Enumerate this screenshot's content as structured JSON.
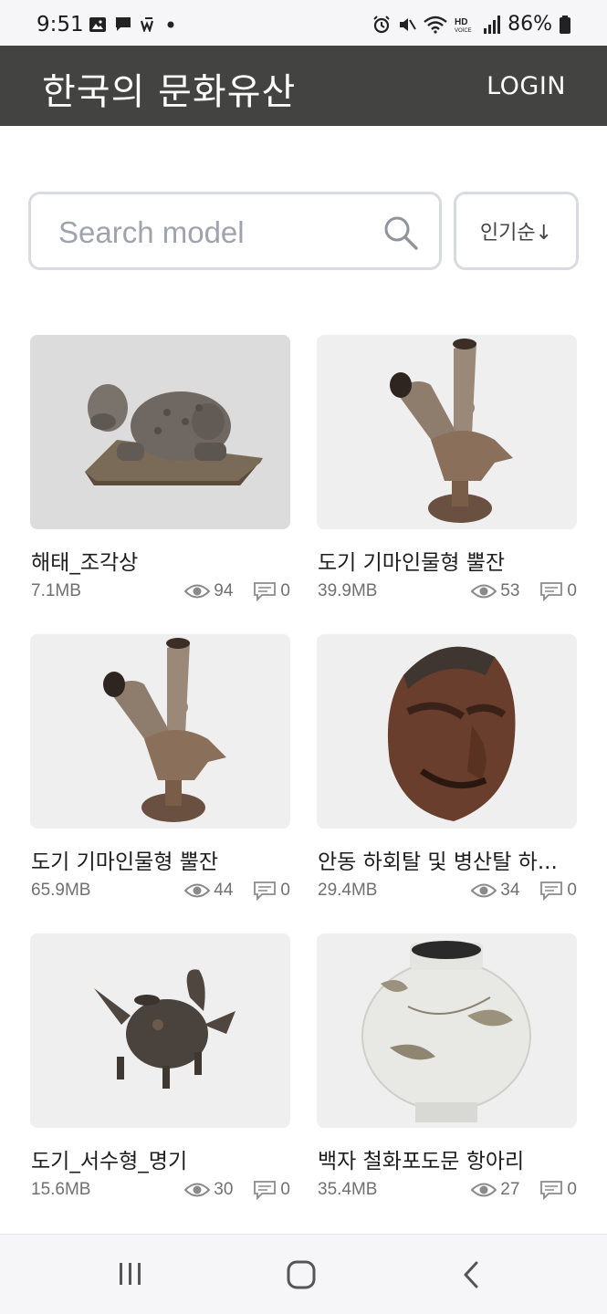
{
  "status": {
    "time": "9:51",
    "battery": "86%",
    "left_icons": [
      "image-icon",
      "message-icon",
      "w-app-icon",
      "dot-icon"
    ],
    "right_icons": [
      "alarm-icon",
      "mute-icon",
      "wifi-icon",
      "hd-voice-icon",
      "signal-icon",
      "battery-icon"
    ]
  },
  "app": {
    "title": "한국의 문화유산",
    "login_label": "LOGIN"
  },
  "search": {
    "placeholder": "Search model",
    "value": "",
    "sort_label": "인기순↓"
  },
  "models": [
    {
      "title": "해태_조각상",
      "size": "7.1MB",
      "views": "94",
      "comments": "0",
      "thumb": "haetae-statue"
    },
    {
      "title": "도기 기마인물형 뿔잔",
      "size": "39.9MB",
      "views": "53",
      "comments": "0",
      "thumb": "horse-rider-horn-cup"
    },
    {
      "title": "도기 기마인물형 뿔잔",
      "size": "65.9MB",
      "views": "44",
      "comments": "0",
      "thumb": "horse-rider-horn-cup"
    },
    {
      "title": "안동 하회탈 및 병산탈 하...",
      "size": "29.4MB",
      "views": "34",
      "comments": "0",
      "thumb": "hahoe-mask"
    },
    {
      "title": "도기_서수형_명기",
      "size": "15.6MB",
      "views": "30",
      "comments": "0",
      "thumb": "beast-shaped-vessel"
    },
    {
      "title": "백자 철화포도문 항아리",
      "size": "35.4MB",
      "views": "27",
      "comments": "0",
      "thumb": "white-porcelain-jar"
    }
  ],
  "nav": {
    "icons": [
      "recent-apps-icon",
      "home-icon",
      "back-icon"
    ]
  },
  "colors": {
    "app_bar": "#434341",
    "thumb_bg": "#efefef",
    "border": "#d9dbe1",
    "meta_text": "#707070"
  }
}
